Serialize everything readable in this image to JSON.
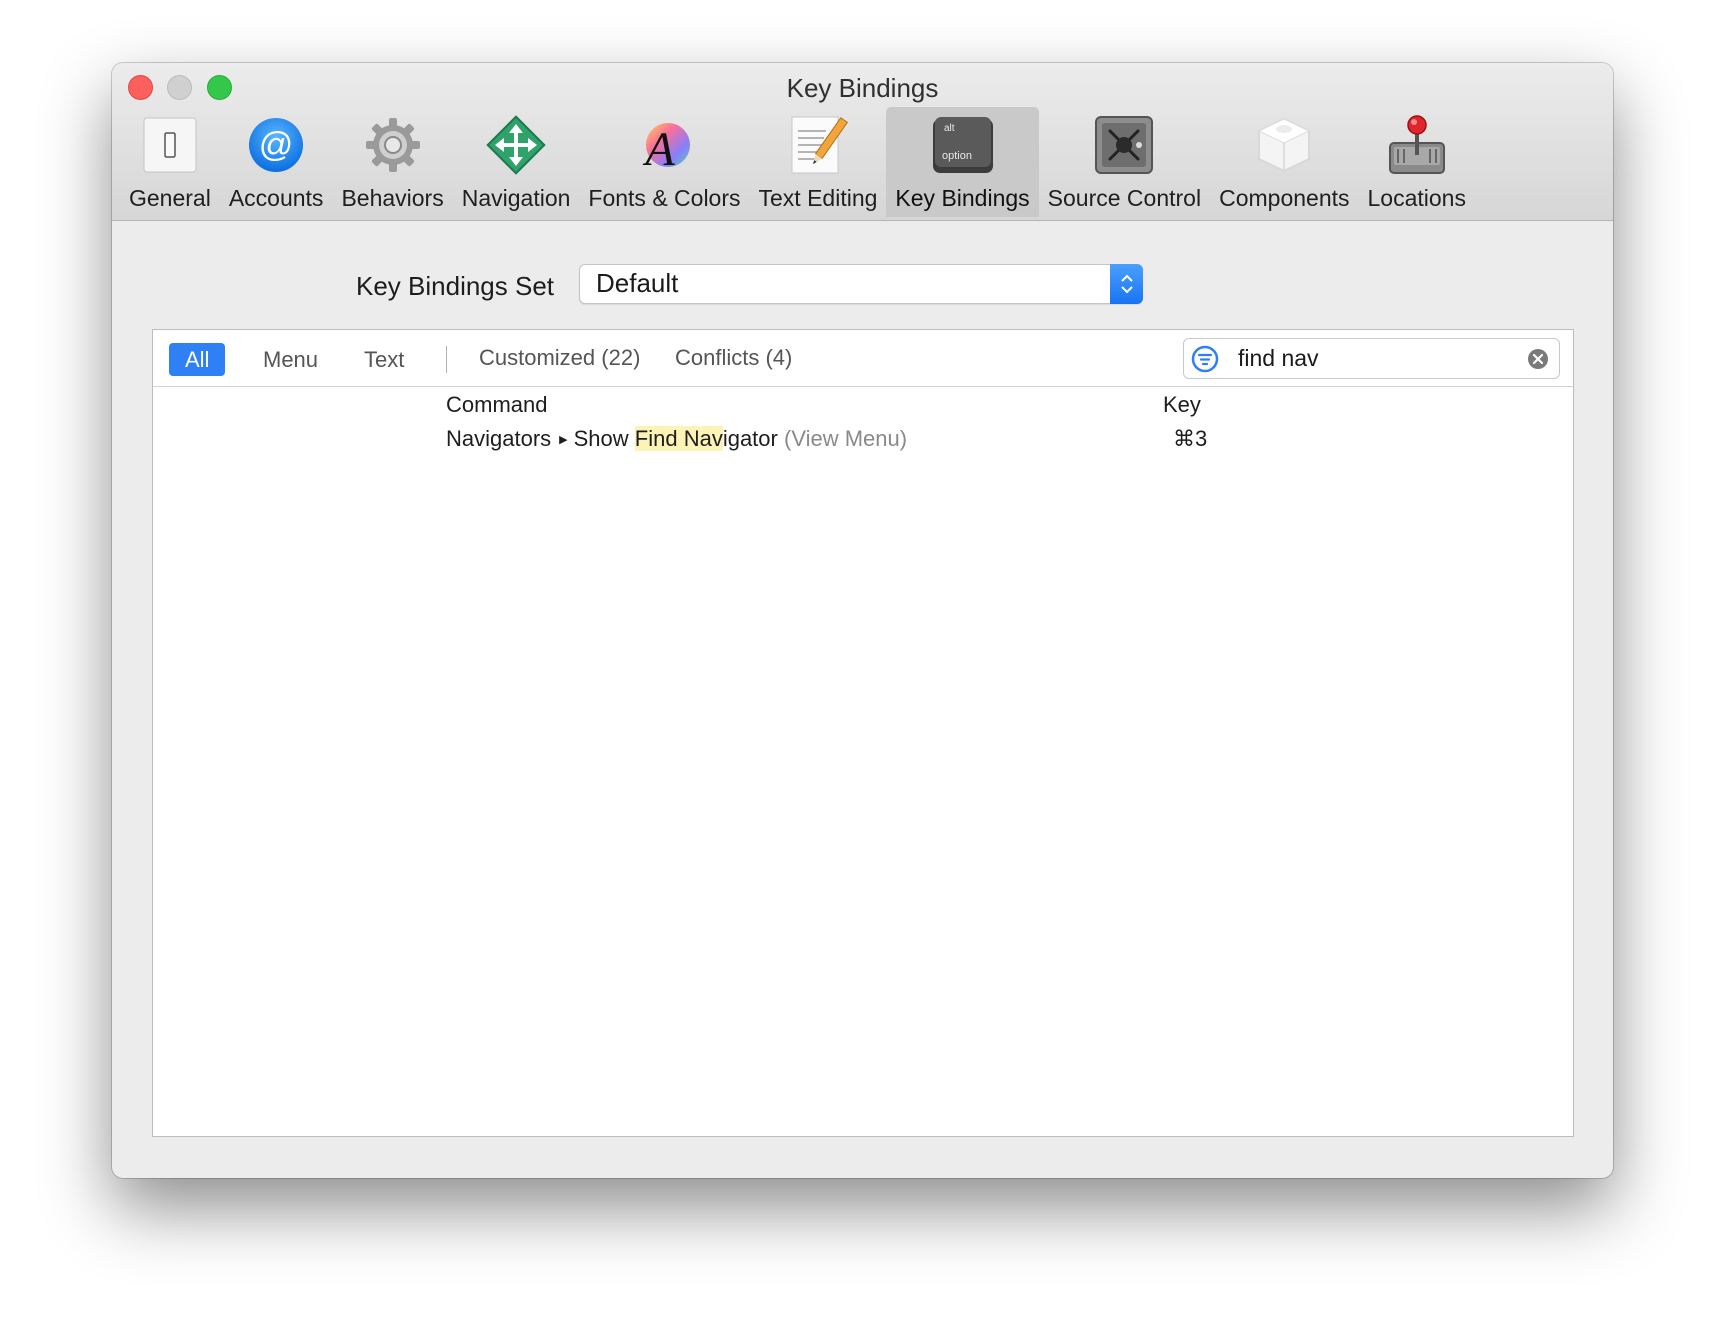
{
  "window": {
    "title": "Key Bindings"
  },
  "toolbar": {
    "items": [
      {
        "label": "General",
        "icon": "general-switch-icon"
      },
      {
        "label": "Accounts",
        "icon": "at-sign-icon"
      },
      {
        "label": "Behaviors",
        "icon": "gear-icon"
      },
      {
        "label": "Navigation",
        "icon": "navigation-arrows-icon"
      },
      {
        "label": "Fonts & Colors",
        "icon": "font-letter-icon"
      },
      {
        "label": "Text Editing",
        "icon": "text-pencil-icon"
      },
      {
        "label": "Key Bindings",
        "icon": "option-key-icon",
        "key_top": "alt",
        "key_bottom": "option"
      },
      {
        "label": "Source Control",
        "icon": "vault-safe-icon"
      },
      {
        "label": "Components",
        "icon": "component-box-icon"
      },
      {
        "label": "Locations",
        "icon": "joystick-drive-icon"
      }
    ],
    "selected": "Key Bindings"
  },
  "key_bindings_set": {
    "label": "Key Bindings Set",
    "value": "Default"
  },
  "filters": {
    "all": "All",
    "menu": "Menu",
    "text": "Text",
    "customized": "Customized (22)",
    "conflicts": "Conflicts (4)",
    "active": "All"
  },
  "search": {
    "value": "find nav",
    "placeholder": ""
  },
  "table": {
    "headers": {
      "command": "Command",
      "key": "Key"
    },
    "rows": [
      {
        "group": "Navigators",
        "prefix": "Show ",
        "match": "Find Nav",
        "suffix": "igator",
        "menu": "(View Menu)",
        "key": "⌘3"
      }
    ]
  },
  "colors": {
    "accent": "#2f7ff5",
    "close": "#fc605c",
    "maximize": "#34c84a",
    "highlight": "#fdf3b6"
  }
}
